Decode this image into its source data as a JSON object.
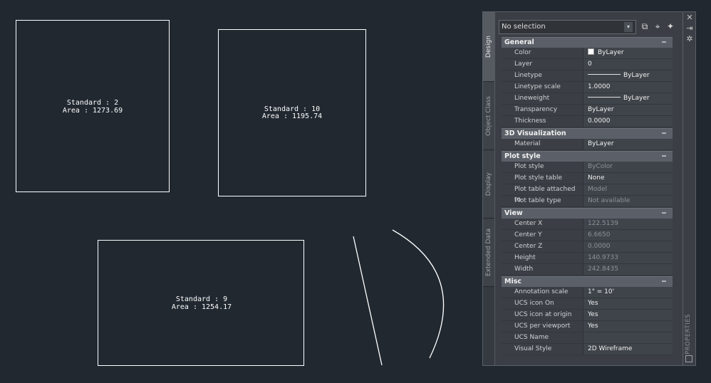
{
  "drawing": {
    "labels": [
      {
        "standard": "Standard : 2",
        "area": "Area : 1273.69"
      },
      {
        "standard": "Standard : 10",
        "area": "Area : 1195.74"
      },
      {
        "standard": "Standard : 9",
        "area": "Area : 1254.17"
      }
    ]
  },
  "palette": {
    "selection": "No selection",
    "tabs": [
      "Design",
      "Object Class",
      "Display",
      "Extended Data"
    ],
    "title": "PROPERTIES",
    "categories": [
      {
        "name": "General",
        "toggle": "−",
        "props": [
          {
            "name": "Color",
            "value": "ByLayer"
          },
          {
            "name": "Layer",
            "value": "0"
          },
          {
            "name": "Linetype",
            "value": "ByLayer"
          },
          {
            "name": "Linetype scale",
            "value": "1.0000"
          },
          {
            "name": "Lineweight",
            "value": "ByLayer"
          },
          {
            "name": "Transparency",
            "value": "ByLayer"
          },
          {
            "name": "Thickness",
            "value": "0.0000"
          }
        ]
      },
      {
        "name": "3D Visualization",
        "toggle": "−",
        "props": [
          {
            "name": "Material",
            "value": "ByLayer"
          }
        ]
      },
      {
        "name": "Plot style",
        "toggle": "−",
        "props": [
          {
            "name": "Plot style",
            "value": "ByColor"
          },
          {
            "name": "Plot style table",
            "value": "None"
          },
          {
            "name": "Plot table attached to",
            "value": "Model"
          },
          {
            "name": "Plot table type",
            "value": "Not available"
          }
        ]
      },
      {
        "name": "View",
        "toggle": "−",
        "props": [
          {
            "name": "Center X",
            "value": "122.5139"
          },
          {
            "name": "Center Y",
            "value": "6.6650"
          },
          {
            "name": "Center Z",
            "value": "0.0000"
          },
          {
            "name": "Height",
            "value": "140.9733"
          },
          {
            "name": "Width",
            "value": "242.8435"
          }
        ]
      },
      {
        "name": "Misc",
        "toggle": "−",
        "props": [
          {
            "name": "Annotation scale",
            "value": "1\" = 10'"
          },
          {
            "name": "UCS icon On",
            "value": "Yes"
          },
          {
            "name": "UCS icon at origin",
            "value": "Yes"
          },
          {
            "name": "UCS per viewport",
            "value": "Yes"
          },
          {
            "name": "UCS Name",
            "value": ""
          },
          {
            "name": "Visual Style",
            "value": "2D Wireframe"
          }
        ]
      }
    ]
  },
  "icons": {
    "quick_select": "quick-select-icon",
    "select_objects": "select-objects-icon",
    "pickadd": "pickadd-toggle-icon",
    "close": "close-icon",
    "autohide": "auto-hide-icon",
    "settings": "settings-icon"
  }
}
